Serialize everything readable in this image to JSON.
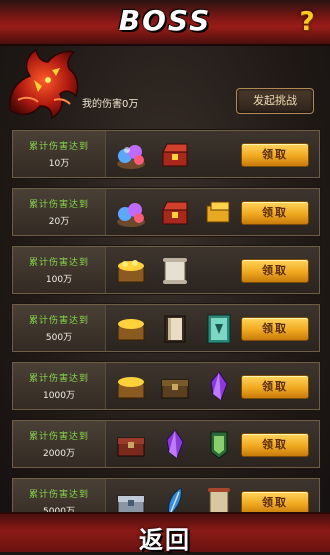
{
  "header": {
    "title": "BOSS",
    "help_label": "?"
  },
  "boss": {
    "damage_label": "我的伤害0万",
    "challenge_label": "发起挑战"
  },
  "rewards": [
    {
      "line1": "累计伤害达到",
      "line2": "10万",
      "items": [
        "gems-icon",
        "treasure-chest-red-icon"
      ],
      "claim_label": "领取"
    },
    {
      "line1": "累计伤害达到",
      "line2": "20万",
      "items": [
        "gems-icon",
        "treasure-chest-red-icon",
        "gold-bars-icon"
      ],
      "claim_label": "领取"
    },
    {
      "line1": "累计伤害达到",
      "line2": "100万",
      "items": [
        "gold-chest-icon",
        "scroll-icon"
      ],
      "claim_label": "领取"
    },
    {
      "line1": "累计伤害达到",
      "line2": "500万",
      "items": [
        "gold-chest-icon",
        "book-icon",
        "rune-card-icon"
      ],
      "claim_label": "领取"
    },
    {
      "line1": "累计伤害达到",
      "line2": "1000万",
      "items": [
        "gold-chest-icon",
        "wooden-chest-icon",
        "purple-crystal-icon"
      ],
      "claim_label": "领取"
    },
    {
      "line1": "累计伤害达到",
      "line2": "2000万",
      "items": [
        "red-chest-icon",
        "purple-crystal-icon",
        "badge-icon"
      ],
      "claim_label": "领取"
    },
    {
      "line1": "累计伤害达到",
      "line2": "5000万",
      "items": [
        "silver-chest-icon",
        "blue-feather-icon",
        "scroll-map-icon"
      ],
      "claim_label": "领取"
    }
  ],
  "footer": {
    "back_label": "返回"
  }
}
